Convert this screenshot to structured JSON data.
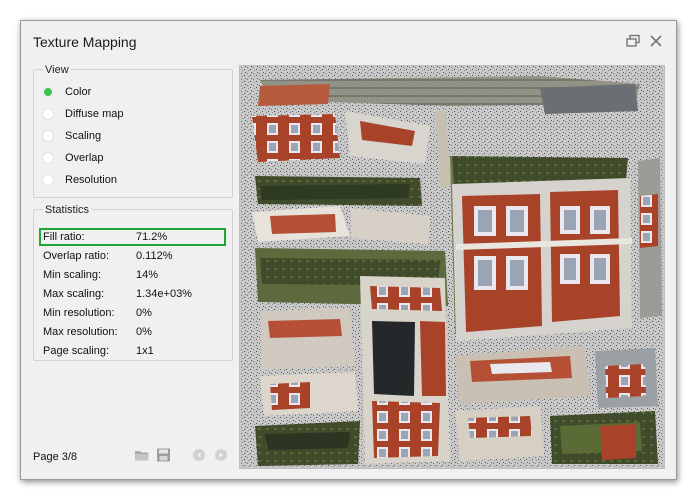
{
  "window": {
    "title": "Texture Mapping"
  },
  "view": {
    "title": "View",
    "options": [
      {
        "label": "Color",
        "checked": true
      },
      {
        "label": "Diffuse map",
        "checked": false
      },
      {
        "label": "Scaling",
        "checked": false
      },
      {
        "label": "Overlap",
        "checked": false
      },
      {
        "label": "Resolution",
        "checked": false
      }
    ]
  },
  "statistics": {
    "title": "Statistics",
    "rows": [
      {
        "key": "Fill ratio:",
        "value": "71.2%"
      },
      {
        "key": "Overlap ratio:",
        "value": "0.112%"
      },
      {
        "key": "Min scaling:",
        "value": "14%"
      },
      {
        "key": "Max scaling:",
        "value": "1.34e+03%"
      },
      {
        "key": "Min resolution:",
        "value": "0%"
      },
      {
        "key": "Max resolution:",
        "value": "0%"
      },
      {
        "key": "Page scaling:",
        "value": "1x1"
      }
    ]
  },
  "footer": {
    "page": "Page 3/8"
  },
  "colors": {
    "accent": "#37c24b",
    "highlight": "#22a535",
    "brick": "#a8432a",
    "texture_bg": "#c9c9c9"
  }
}
